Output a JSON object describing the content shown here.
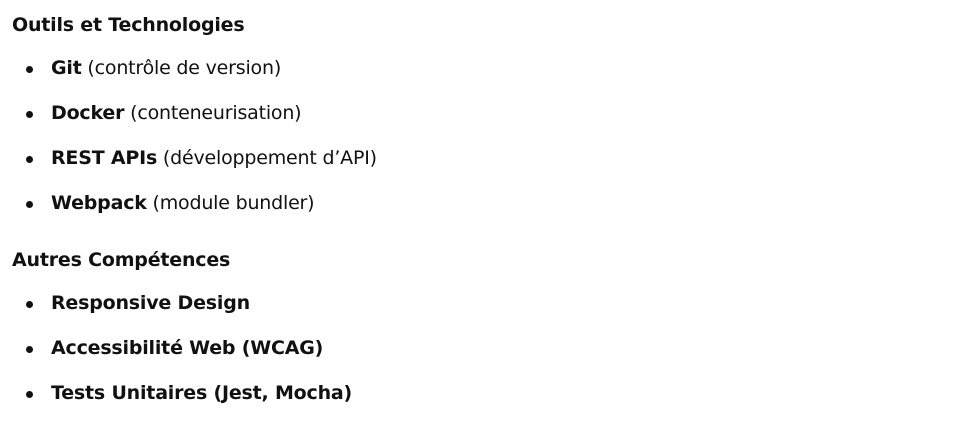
{
  "sections": [
    {
      "title": "Outils et Technologies",
      "items": [
        {
          "strong": "Git",
          "rest": " (contrôle de version)"
        },
        {
          "strong": "Docker",
          "rest": " (conteneurisation)"
        },
        {
          "strong": "REST APIs",
          "rest": " (développement d’API)"
        },
        {
          "strong": "Webpack",
          "rest": " (module bundler)"
        }
      ]
    },
    {
      "title": "Autres Compétences",
      "items": [
        {
          "strong": "Responsive Design",
          "rest": ""
        },
        {
          "strong": "Accessibilité Web (WCAG)",
          "rest": ""
        },
        {
          "strong": "Tests Unitaires (Jest, Mocha)",
          "rest": ""
        }
      ]
    }
  ]
}
